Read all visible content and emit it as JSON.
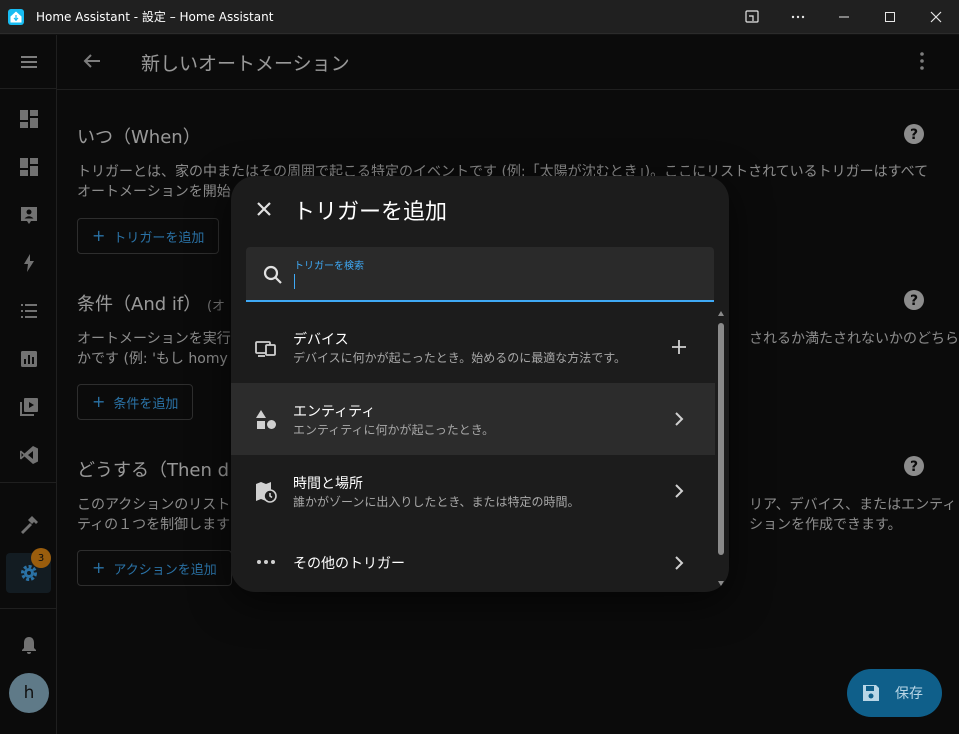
{
  "window": {
    "title": "Home Assistant - 設定 – Home Assistant"
  },
  "sidebar": {
    "badge_count": "3",
    "avatar_letter": "h"
  },
  "appbar": {
    "title": "新しいオートメーション"
  },
  "sections": {
    "when": {
      "heading": "いつ（When）",
      "desc_line1": "トリガーとは、家の中またはその周囲で起こる特定のイベントです (例:「太陽が沈むとき」)。ここにリストされているトリガーはすべて",
      "desc_line2": "オートメーションを開始",
      "button": "トリガーを追加"
    },
    "and_if": {
      "heading": "条件（And if）",
      "heading_suffix": "(オ",
      "desc_line1_start": "オートメーションを実行",
      "desc_line1_end": "されるか満たされないかのどちら",
      "desc_line2_start": "かです (例: 'もし homy か",
      "button": "条件を追加"
    },
    "then": {
      "heading": "どうする（Then d",
      "desc_line1_start": "このアクションのリスト",
      "desc_line1_end": "リア、デバイス、またはエンティ",
      "desc_line2_start": "ティの１つを制御します",
      "desc_line2_end": "ションを作成できます。",
      "button": "アクションを追加"
    }
  },
  "fab": {
    "label": "保存"
  },
  "dialog": {
    "title": "トリガーを追加",
    "search_label": "トリガーを検索",
    "search_value": "",
    "items": [
      {
        "title": "デバイス",
        "subtitle": "デバイスに何かが起こったとき。始めるのに最適な方法です。",
        "meta": "plus-icon"
      },
      {
        "title": "エンティティ",
        "subtitle": "エンティティに何かが起こったとき。",
        "meta": "chevron-right-icon"
      },
      {
        "title": "時間と場所",
        "subtitle": "誰かがゾーンに出入りしたとき、または特定の時間。",
        "meta": "chevron-right-icon"
      },
      {
        "title": "その他のトリガー",
        "subtitle": "",
        "meta": "chevron-right-icon"
      }
    ]
  },
  "colors": {
    "accent": "#3fa9f5",
    "badge": "#e38a14",
    "fab": "#0f5f8a",
    "background": "#111111",
    "dialog": "#1c1c1c"
  }
}
